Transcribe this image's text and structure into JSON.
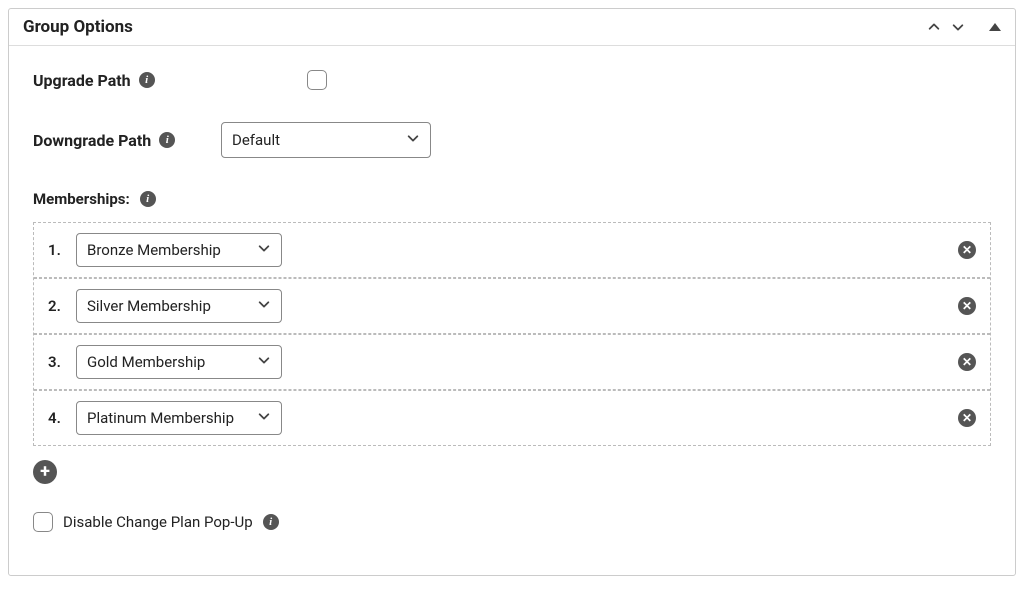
{
  "panel": {
    "title": "Group Options"
  },
  "upgrade": {
    "label": "Upgrade Path"
  },
  "downgrade": {
    "label": "Downgrade Path",
    "value": "Default"
  },
  "memberships": {
    "label": "Memberships:",
    "items": [
      {
        "num": "1.",
        "value": "Bronze Membership"
      },
      {
        "num": "2.",
        "value": "Silver Membership"
      },
      {
        "num": "3.",
        "value": "Gold Membership"
      },
      {
        "num": "4.",
        "value": "Platinum Membership"
      }
    ]
  },
  "disable_popup": {
    "label": "Disable Change Plan Pop-Up"
  }
}
